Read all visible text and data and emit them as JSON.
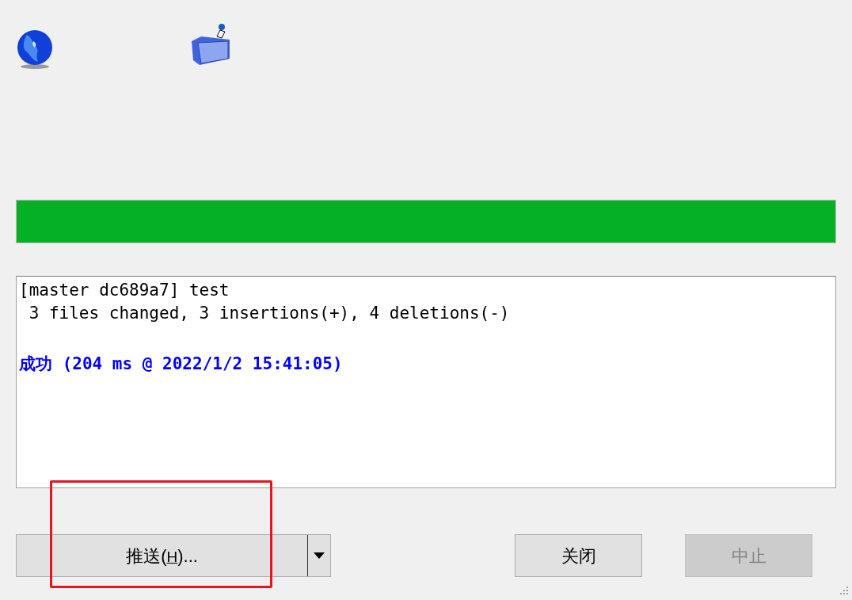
{
  "progress": {
    "level": 1
  },
  "log": [
    {
      "kind": "plain",
      "text": "[master dc689a7] test"
    },
    {
      "kind": "plain",
      "text": " 3 files changed, 3 insertions(+), 4 deletions(-)"
    },
    {
      "kind": "blank"
    },
    {
      "kind": "success",
      "text": "成功 (204 ms @ 2022/1/2 15:41:05)"
    }
  ],
  "split_button": {
    "label_before": "推送(",
    "access_key": "H",
    "label_after": ")..."
  },
  "buttons": [
    {
      "label": "关闭",
      "disabled": false
    },
    {
      "label": "中止",
      "disabled": true
    }
  ],
  "annotation": {
    "kind": "frame"
  }
}
